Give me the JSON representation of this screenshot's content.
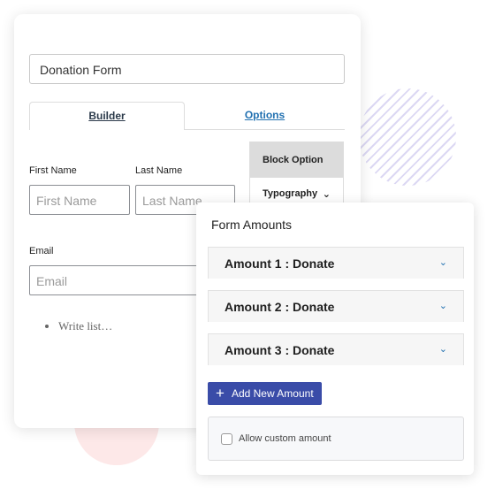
{
  "builder": {
    "form_title": "Donation Form",
    "tabs": [
      {
        "label": "Builder",
        "active": true
      },
      {
        "label": "Options",
        "active": false
      }
    ],
    "fields": {
      "first_name": {
        "label": "First Name",
        "placeholder": "First Name"
      },
      "last_name": {
        "label": "Last Name",
        "placeholder": "Last Name"
      },
      "email": {
        "label": "Email",
        "placeholder": "Email"
      }
    },
    "list_placeholder": "Write list…",
    "side_panel": {
      "block_option": "Block Option",
      "typography": "Typography"
    }
  },
  "form_amounts": {
    "title": "Form Amounts",
    "amounts": [
      {
        "label": "Amount 1 : Donate"
      },
      {
        "label": "Amount 2 : Donate"
      },
      {
        "label": "Amount 3 : Donate"
      }
    ],
    "add_button": "Add New Amount",
    "allow_custom": {
      "label": "Allow custom amount",
      "checked": false
    }
  },
  "colors": {
    "accent": "#3a4ca8",
    "link": "#2271b1"
  }
}
